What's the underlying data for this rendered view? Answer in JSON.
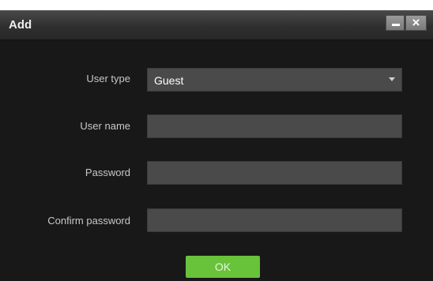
{
  "dialog": {
    "title": "Add",
    "minimize_icon": "minimize-icon",
    "close_icon": "close-icon",
    "close_glyph": "×"
  },
  "form": {
    "user_type": {
      "label": "User type",
      "value": "Guest"
    },
    "user_name": {
      "label": "User name",
      "value": ""
    },
    "password": {
      "label": "Password",
      "value": ""
    },
    "confirm_password": {
      "label": "Confirm password",
      "value": ""
    }
  },
  "actions": {
    "ok_label": "OK"
  },
  "colors": {
    "dialog_background": "#181818",
    "field_background": "#4a4a4a",
    "ok_button": "#68c23a"
  }
}
